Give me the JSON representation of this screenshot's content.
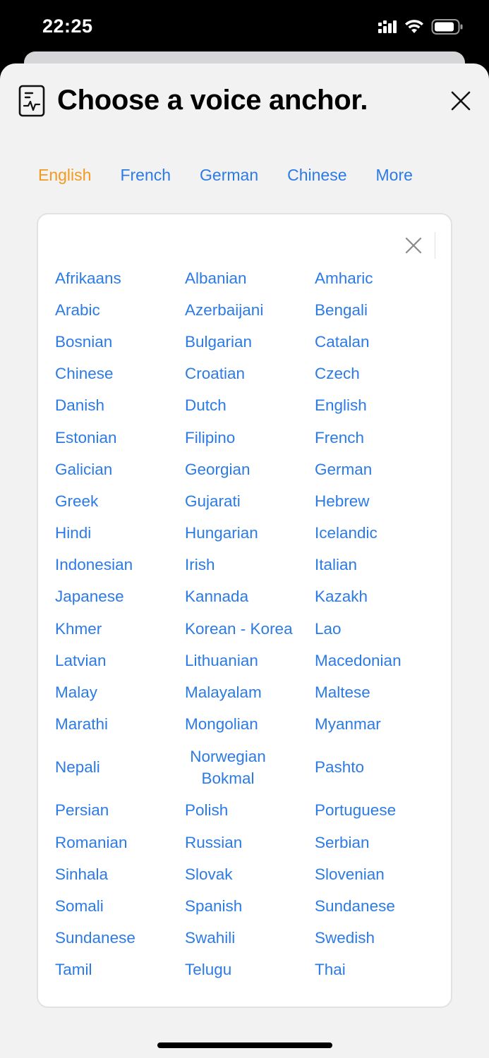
{
  "status": {
    "time": "22:25"
  },
  "header": {
    "title": "Choose a voice anchor."
  },
  "tabs": [
    {
      "label": "English",
      "active": true
    },
    {
      "label": "French",
      "active": false
    },
    {
      "label": "German",
      "active": false
    },
    {
      "label": "Chinese",
      "active": false
    },
    {
      "label": "More",
      "active": false
    }
  ],
  "languages": [
    "Afrikaans",
    "Albanian",
    "Amharic",
    "Arabic",
    "Azerbaijani",
    "Bengali",
    "Bosnian",
    "Bulgarian",
    "Catalan",
    "Chinese",
    "Croatian",
    "Czech",
    "Danish",
    "Dutch",
    "English",
    "Estonian",
    "Filipino",
    "French",
    "Galician",
    "Georgian",
    "German",
    "Greek",
    "Gujarati",
    "Hebrew",
    "Hindi",
    "Hungarian",
    "Icelandic",
    "Indonesian",
    "Irish",
    "Italian",
    "Japanese",
    "Kannada",
    "Kazakh",
    "Khmer",
    "Korean - Korea",
    "Lao",
    "Latvian",
    "Lithuanian",
    "Macedonian",
    "Malay",
    "Malayalam",
    "Maltese",
    "Marathi",
    "Mongolian",
    "Myanmar",
    "Nepali",
    "Norwegian Bokmal",
    "Pashto",
    "Persian",
    "Polish",
    "Portuguese",
    "Romanian",
    "Russian",
    "Serbian",
    "Sinhala",
    "Slovak",
    "Slovenian",
    "Somali",
    "Spanish",
    "Sundanese",
    "Sundanese",
    "Swahili",
    "Swedish",
    "Tamil",
    "Telugu",
    "Thai"
  ],
  "colors": {
    "link": "#2c7be5",
    "active_tab": "#f39a1c"
  }
}
